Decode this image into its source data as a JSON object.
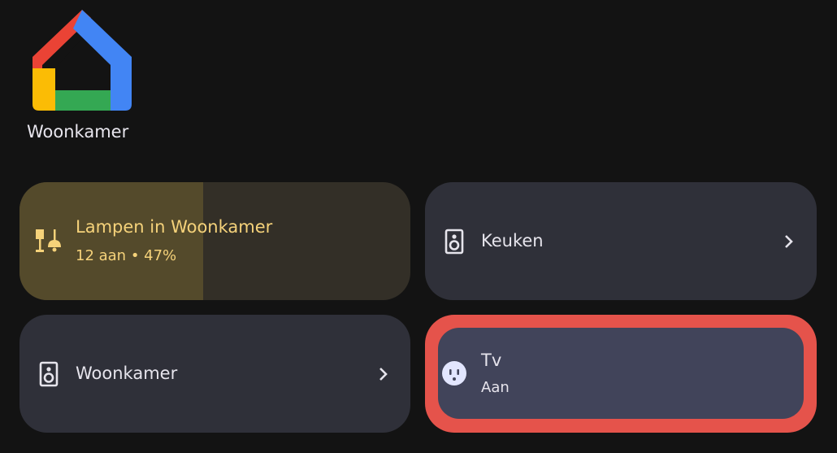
{
  "home": {
    "name": "Woonkamer",
    "logo_colors": {
      "red": "#ea4335",
      "blue": "#4285f4",
      "green": "#34a853",
      "yellow": "#fbbc05"
    }
  },
  "tiles": [
    {
      "title": "Lampen in Woonkamer",
      "subtitle": "12 aan • 47%",
      "icon": "lamp-icon",
      "level_percent": 47,
      "color": "#f5d27a"
    },
    {
      "title": "Keuken",
      "icon": "speaker-icon",
      "chevron": "chevron-right-icon"
    },
    {
      "title": "Woonkamer",
      "icon": "speaker-icon",
      "chevron": "chevron-right-icon"
    },
    {
      "title": "Tv",
      "subtitle": "Aan",
      "icon": "outlet-icon",
      "highlight_color": "#e5534b"
    }
  ]
}
